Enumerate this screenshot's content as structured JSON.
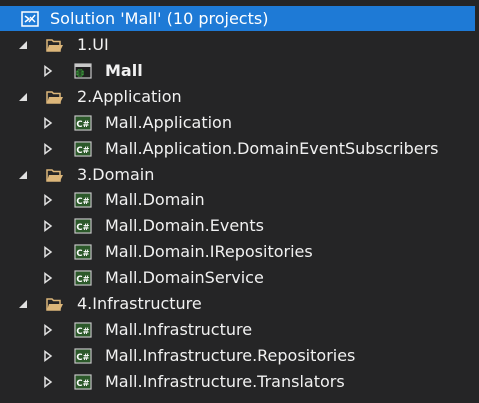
{
  "solution": {
    "title": "Solution 'Mall' (10 projects)",
    "icon": "solution-icon",
    "selected": true
  },
  "folders": [
    {
      "name": "1.UI",
      "expanded": true,
      "icon": "folder-open-icon",
      "projects": [
        {
          "name": "Mall",
          "icon": "web-project-icon",
          "bold": true,
          "expanded": false
        }
      ]
    },
    {
      "name": "2.Application",
      "expanded": true,
      "icon": "folder-open-icon",
      "projects": [
        {
          "name": "Mall.Application",
          "icon": "csharp-project-icon",
          "bold": false,
          "expanded": false
        },
        {
          "name": "Mall.Application.DomainEventSubscribers",
          "icon": "csharp-project-icon",
          "bold": false,
          "expanded": false
        }
      ]
    },
    {
      "name": "3.Domain",
      "expanded": true,
      "icon": "folder-open-icon",
      "projects": [
        {
          "name": "Mall.Domain",
          "icon": "csharp-project-icon",
          "bold": false,
          "expanded": false
        },
        {
          "name": "Mall.Domain.Events",
          "icon": "csharp-project-icon",
          "bold": false,
          "expanded": false
        },
        {
          "name": "Mall.Domain.IRepositories",
          "icon": "csharp-project-icon",
          "bold": false,
          "expanded": false
        },
        {
          "name": "Mall.DomainService",
          "icon": "csharp-project-icon",
          "bold": false,
          "expanded": false
        }
      ]
    },
    {
      "name": "4.Infrastructure",
      "expanded": true,
      "icon": "folder-open-icon",
      "projects": [
        {
          "name": "Mall.Infrastructure",
          "icon": "csharp-project-icon",
          "bold": false,
          "expanded": false
        },
        {
          "name": "Mall.Infrastructure.Repositories",
          "icon": "csharp-project-icon",
          "bold": false,
          "expanded": false
        },
        {
          "name": "Mall.Infrastructure.Translators",
          "icon": "csharp-project-icon",
          "bold": false,
          "expanded": false
        }
      ]
    }
  ],
  "colors": {
    "background": "#252526",
    "selection": "#1e7ad6",
    "text": "#f1f1f1",
    "folder": "#dcb67a",
    "csharp_icon": "#388a34"
  }
}
